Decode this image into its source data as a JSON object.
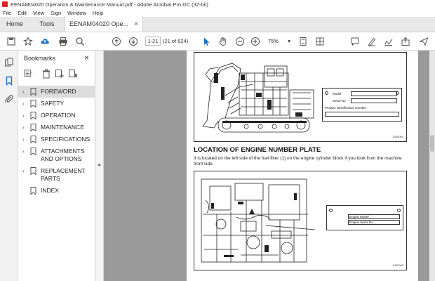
{
  "window": {
    "title": "EENAM04020 Operation & Maintenance Manual.pdf - Adobe Acrobat Pro DC (32-bit)"
  },
  "menu": [
    "File",
    "Edit",
    "View",
    "Sign",
    "Window",
    "Help"
  ],
  "tabs": {
    "home": "Home",
    "tools": "Tools",
    "doc": "EENAM04020 Ope..."
  },
  "toolbar": {
    "page_current": "1-21",
    "page_total": "(21 of 624)",
    "zoom": "75%"
  },
  "bookmarks": {
    "header": "Bookmarks",
    "items": [
      {
        "label": "FOREWORD",
        "expandable": true,
        "selected": true
      },
      {
        "label": "SAFETY",
        "expandable": true,
        "selected": false
      },
      {
        "label": "OPERATION",
        "expandable": true,
        "selected": false
      },
      {
        "label": "MAINTENANCE",
        "expandable": true,
        "selected": false
      },
      {
        "label": "SPECIFICATIONS",
        "expandable": true,
        "selected": false
      },
      {
        "label": "ATTACHMENTS AND OPTIONS",
        "expandable": true,
        "selected": false
      },
      {
        "label": "REPLACEMENT PARTS",
        "expandable": true,
        "selected": false
      },
      {
        "label": "INDEX",
        "expandable": false,
        "selected": false
      }
    ]
  },
  "document": {
    "section_title": "LOCATION OF ENGINE NUMBER PLATE",
    "section_body": "It is located on the left side of the fuel filter (1) on the engine cylinder block if you look from the machine front side.",
    "plate1": {
      "row1": "Model",
      "row2": "Serial No.",
      "row3": "Product Identification Number"
    },
    "plate2": {
      "row1": "Engine Model",
      "row2": "Engine Serial No."
    },
    "fig1_id": "5J00001",
    "fig2_id": "5J00002"
  }
}
